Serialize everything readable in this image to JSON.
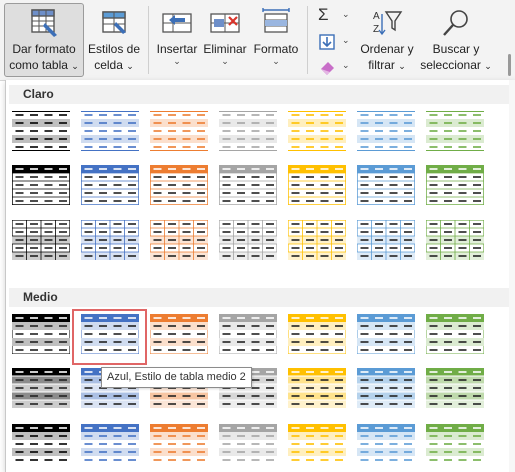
{
  "ribbon": {
    "format_table": {
      "line1": "Dar formato",
      "line2": "como tabla",
      "chevron": "⌄"
    },
    "cell_styles": {
      "line1": "Estilos de",
      "line2": "celda",
      "chevron": "⌄"
    },
    "insert": {
      "label": "Insertar",
      "chevron": "⌄"
    },
    "delete": {
      "label": "Eliminar",
      "chevron": "⌄"
    },
    "format": {
      "label": "Formato",
      "chevron": "⌄"
    },
    "sort_filter": {
      "line1": "Ordenar y",
      "line2": "filtrar",
      "chevron": "⌄"
    },
    "find_select": {
      "line1": "Buscar y",
      "line2": "seleccionar",
      "chevron": "⌄"
    },
    "small_dropdown": "⌄",
    "sigma_symbol": "Σ"
  },
  "gallery": {
    "section_light": "Claro",
    "section_medium": "Medio",
    "theme_colors": [
      "#000000",
      "#4472c4",
      "#ed7d31",
      "#a5a5a5",
      "#ffc000",
      "#5b9bd5",
      "#70ad47"
    ],
    "light_rows": [
      {
        "style": "light-banded"
      },
      {
        "style": "light-header"
      },
      {
        "style": "light-grid"
      }
    ],
    "medium_rows": [
      {
        "style": "medium-header"
      },
      {
        "style": "medium-banded"
      },
      {
        "style": "medium-plain"
      }
    ],
    "selected_style": "Azul, Estilo de tabla medio 2"
  },
  "tooltip": {
    "text": "Azul, Estilo de tabla medio 2"
  }
}
